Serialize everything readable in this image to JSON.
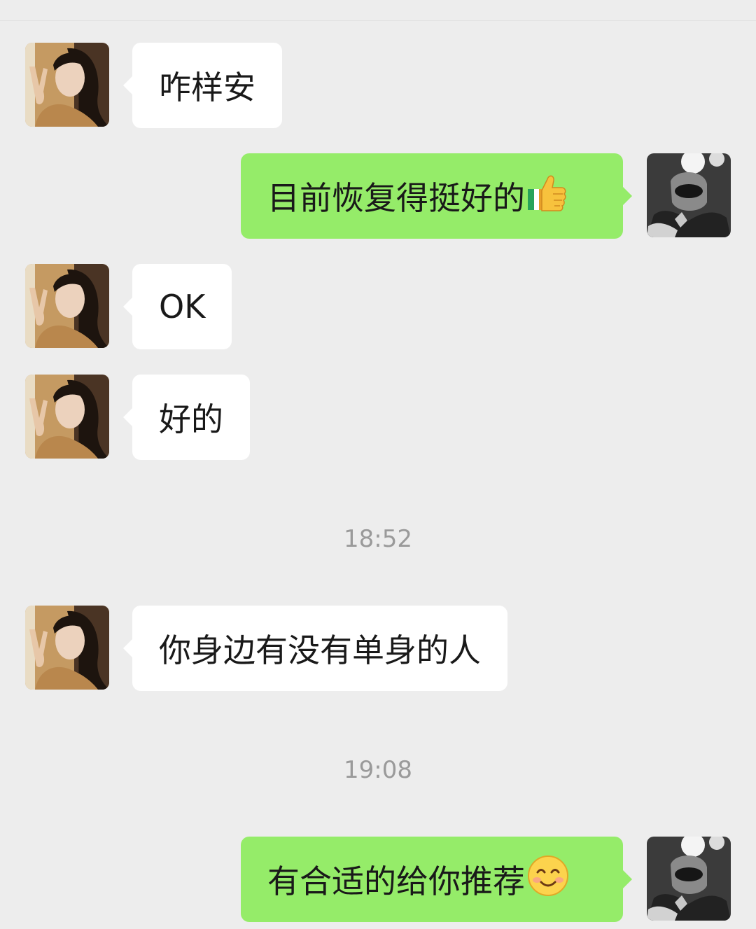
{
  "chat": {
    "messages": [
      {
        "sender": "contact",
        "text": "咋样安"
      },
      {
        "sender": "me",
        "text": "目前恢复得挺好的",
        "emoji": "thumbs-up-icon"
      },
      {
        "sender": "contact",
        "text": "OK"
      },
      {
        "sender": "contact",
        "text": "好的"
      },
      {
        "sender": "contact",
        "text": "你身边有没有单身的人"
      },
      {
        "sender": "me",
        "text": "有合适的给你推荐",
        "emoji": "smiling-face-icon"
      }
    ],
    "timestamps": [
      "18:52",
      "19:08"
    ]
  },
  "colors": {
    "background": "#ededed",
    "incoming_bubble": "#ffffff",
    "outgoing_bubble": "#95ec69",
    "timestamp_text": "#9a9a9a"
  }
}
